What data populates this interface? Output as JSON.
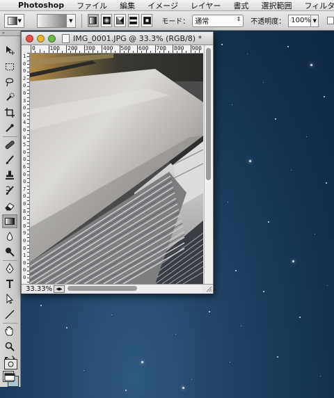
{
  "menubar": {
    "app": "Photoshop",
    "items": [
      "ファイル",
      "編集",
      "イメージ",
      "レイヤー",
      "書式",
      "選択範囲",
      "フィルター"
    ]
  },
  "options": {
    "mode_label": "モード：",
    "mode_value": "通常",
    "opacity_label": "不透明度：",
    "opacity_value": "100%"
  },
  "document": {
    "title": "IMG_0001.JPG @ 33.3% (RGB/8) *",
    "zoom": "33.33%",
    "h_ruler": [
      "0",
      "100",
      "200",
      "300",
      "400",
      "500",
      "600",
      "700",
      "800",
      "900"
    ],
    "v_ruler": [
      "1",
      "0",
      "0",
      "2",
      "0",
      "0",
      "3",
      "0",
      "0",
      "4",
      "0",
      "0",
      "5",
      "0",
      "0",
      "6",
      "0",
      "0",
      "7",
      "0",
      "0",
      "8",
      "0",
      "0",
      "9",
      "0",
      "0",
      "1",
      "0",
      "0",
      "0"
    ]
  },
  "toolbox": {
    "tools": [
      "move-tool",
      "marquee-tool",
      "lasso-tool",
      "quick-selection-tool",
      "crop-tool",
      "eyedropper-tool",
      "healing-brush-tool",
      "brush-tool",
      "clone-stamp-tool",
      "history-brush-tool",
      "eraser-tool",
      "gradient-tool",
      "blur-tool",
      "dodge-tool",
      "pen-tool",
      "type-tool",
      "path-selection-tool",
      "line-tool",
      "hand-tool",
      "zoom-tool"
    ],
    "selected": "gradient-tool"
  },
  "colors": {
    "foreground": "#9b9b9b",
    "background": "#a9c8d3",
    "desktop": "#1f4264"
  }
}
